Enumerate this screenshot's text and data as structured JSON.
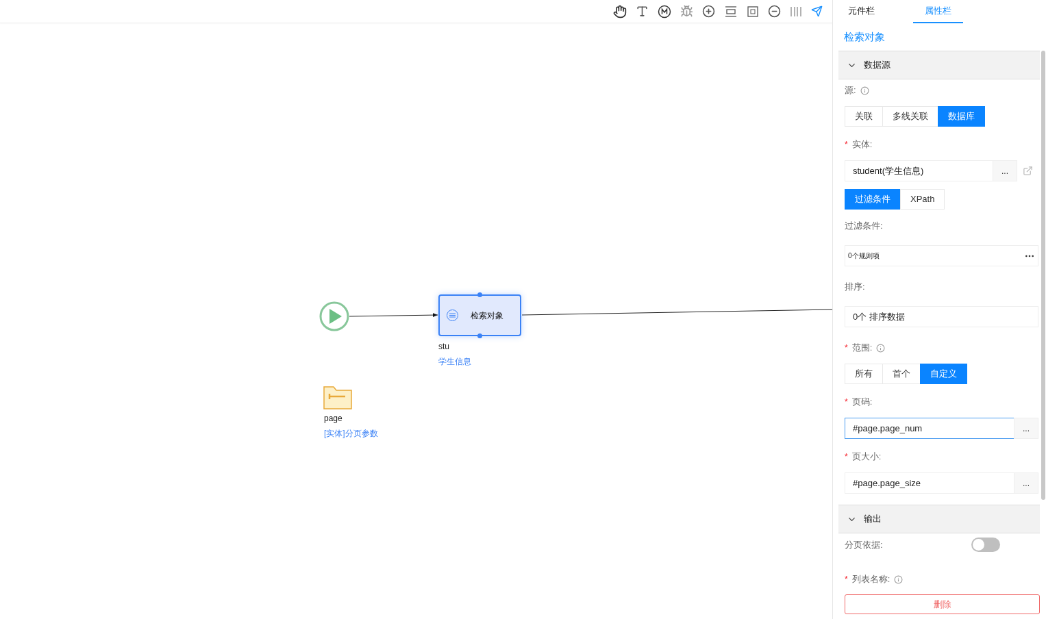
{
  "canvas": {
    "action_node": {
      "title": "检索对象",
      "name": "stu",
      "subtitle": "学生信息"
    },
    "param_node": {
      "name": "page",
      "subtitle": "[实体]分页参数"
    }
  },
  "panel": {
    "tabs": [
      {
        "label": "元件栏",
        "selected": false
      },
      {
        "label": "属性栏",
        "selected": true
      }
    ],
    "title": "检索对象",
    "sections": [
      {
        "title": "数据源",
        "expanded": true,
        "fields": [
          {
            "kind": "segmented",
            "label": "源:",
            "info": true,
            "options": [
              {
                "label": "关联",
                "selected": false
              },
              {
                "label": "多线关联",
                "selected": false
              },
              {
                "label": "数据库",
                "selected": true
              }
            ]
          },
          {
            "kind": "picker",
            "required_mark": "*",
            "label": "实体:",
            "info": false,
            "value": "student(学生信息)",
            "button": "...",
            "link": true,
            "focused": false
          },
          {
            "kind": "tabs",
            "options": [
              {
                "label": "过滤条件",
                "selected": true
              },
              {
                "label": "XPath",
                "selected": false
              }
            ]
          },
          {
            "kind": "rule_summary",
            "label": "过滤条件:",
            "info": false,
            "value": "0个规则项"
          },
          {
            "kind": "summary",
            "label": "排序:",
            "info": false,
            "value": "0个 排序数据"
          },
          {
            "kind": "segmented",
            "required_mark": "*",
            "label": "范围:",
            "info": true,
            "options": [
              {
                "label": "所有",
                "selected": false
              },
              {
                "label": "首个",
                "selected": false
              },
              {
                "label": "自定义",
                "selected": true
              }
            ]
          },
          {
            "kind": "picker",
            "required_mark": "*",
            "label": "页码:",
            "info": false,
            "value": "#page.page_num",
            "button": "...",
            "link": false,
            "focused": true
          },
          {
            "kind": "picker",
            "required_mark": "*",
            "label": "页大小:",
            "info": false,
            "value": "#page.page_size",
            "button": "...",
            "link": false,
            "focused": false
          }
        ]
      },
      {
        "title": "输出",
        "expanded": true,
        "fields": [
          {
            "kind": "toggle",
            "label": "分页依据:",
            "info": false,
            "on": false
          },
          {
            "kind": "label",
            "required_mark": "*",
            "label": "列表名称:",
            "info": true
          }
        ]
      }
    ],
    "delete_button": "删除"
  }
}
